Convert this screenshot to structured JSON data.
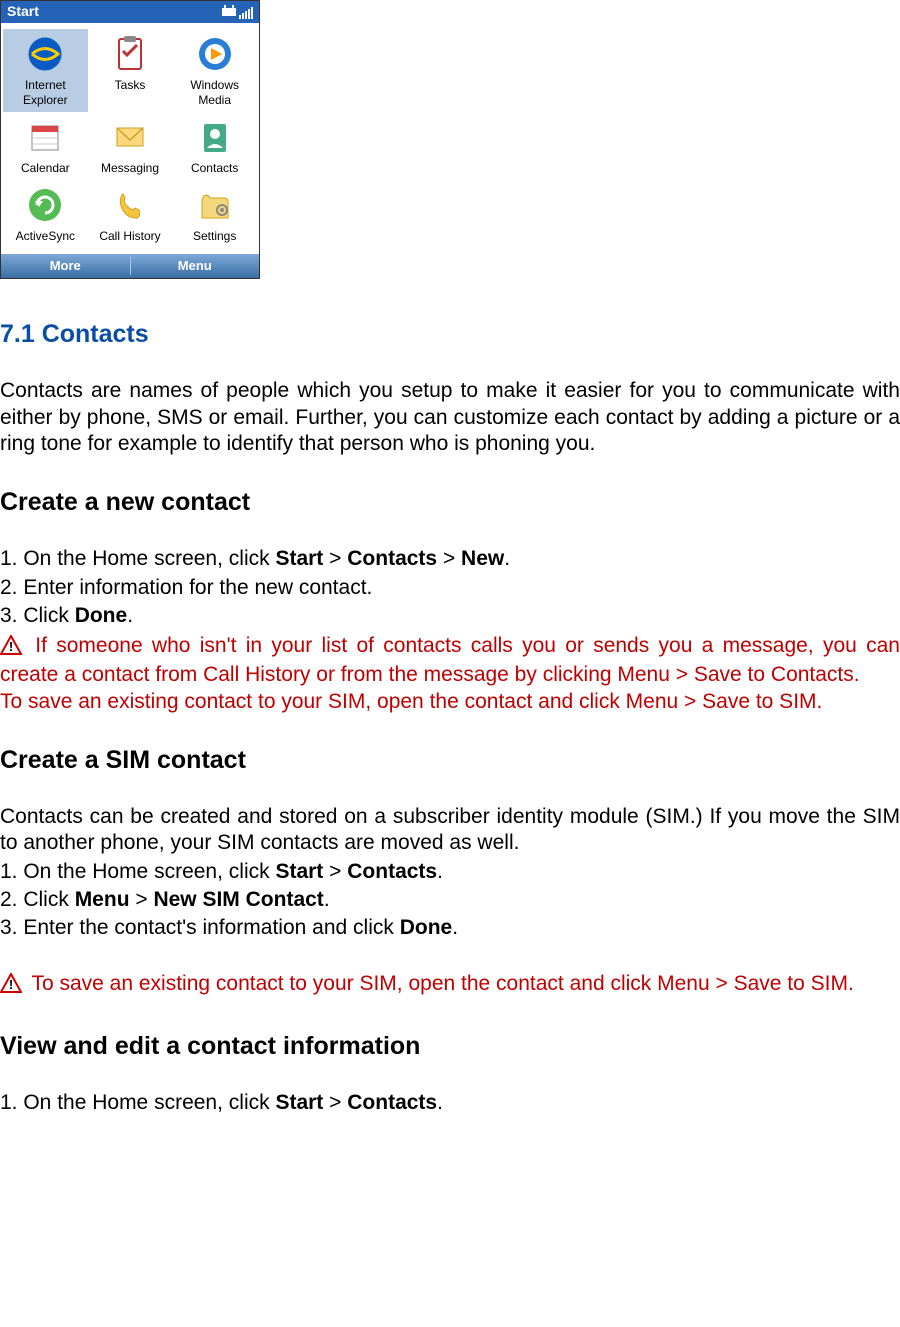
{
  "phone": {
    "topbar_title": "Start",
    "apps": [
      {
        "label": "Internet Explorer"
      },
      {
        "label": "Tasks"
      },
      {
        "label": "Windows Media"
      },
      {
        "label": "Calendar"
      },
      {
        "label": "Messaging"
      },
      {
        "label": "Contacts"
      },
      {
        "label": "ActiveSync"
      },
      {
        "label": "Call History"
      },
      {
        "label": "Settings"
      }
    ],
    "softkey_left": "More",
    "softkey_right": "Menu"
  },
  "doc": {
    "section_title": "7.1 Contacts",
    "intro": "Contacts are names of people which you setup to make it easier for you to communicate with either by phone, SMS or email. Further, you can customize each contact by adding a picture or a ring tone for example to identify that person who is phoning you.",
    "sub1": "Create a new contact",
    "step1_pre": "1. On the Home screen, click ",
    "step1_b1": "Start",
    "gt": " > ",
    "step1_b2": "Contacts",
    "step1_b3": "New",
    "step1_end": ".",
    "step2": "2. Enter information for the new contact.",
    "step3_pre": "3. Click ",
    "step3_b": "Done",
    "step3_end": ".",
    "warn1": " If someone who isn't in your list of contacts calls you or sends you a message, you can create a contact from Call History or from the message by clicking Menu > Save to Contacts.",
    "warn1b": "To save an existing contact to your SIM, open the contact and click Menu > Save to SIM.",
    "sub2": "Create a SIM contact",
    "sim_intro": "Contacts can be created and stored on a subscriber identity module (SIM.) If you move the SIM to another phone, your SIM contacts are moved as well.",
    "sim1_pre": "1. On the Home screen, click ",
    "sim1_b1": "Start",
    "sim1_b2": "Contacts",
    "sim1_end": ".",
    "sim2_pre": "2. Click ",
    "sim2_b1": "Menu",
    "sim2_b2": "New SIM Contact",
    "sim2_end": ".",
    "sim3_pre": "3. Enter the contact's information and click ",
    "sim3_b": "Done",
    "sim3_end": ".",
    "warn2": " To save an existing contact to your SIM, open the contact and click Menu > Save to SIM.",
    "sub3": "View and edit a contact information",
    "view1_pre": "1. On the Home screen, click ",
    "view1_b1": "Start",
    "view1_b2": "Contacts",
    "view1_end": "."
  }
}
